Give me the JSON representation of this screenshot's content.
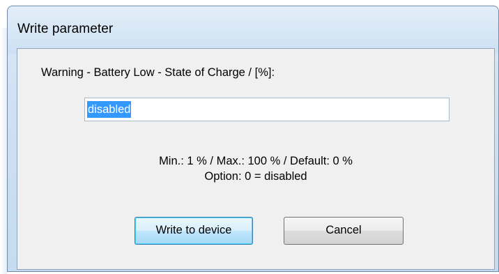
{
  "window": {
    "title": "Write parameter"
  },
  "dialog": {
    "prompt": "Warning - Battery Low - State of Charge / [%]:",
    "input": {
      "value": "disabled"
    },
    "range_line1": "Min.: 1 % / Max.: 100 % / Default: 0 %",
    "range_line2": "Option: 0 = disabled",
    "buttons": {
      "write_label": "Write to device",
      "cancel_label": "Cancel"
    }
  },
  "colors": {
    "selection": "#3399ff",
    "frame": "#cde0f2",
    "client": "#f0f0f0"
  }
}
